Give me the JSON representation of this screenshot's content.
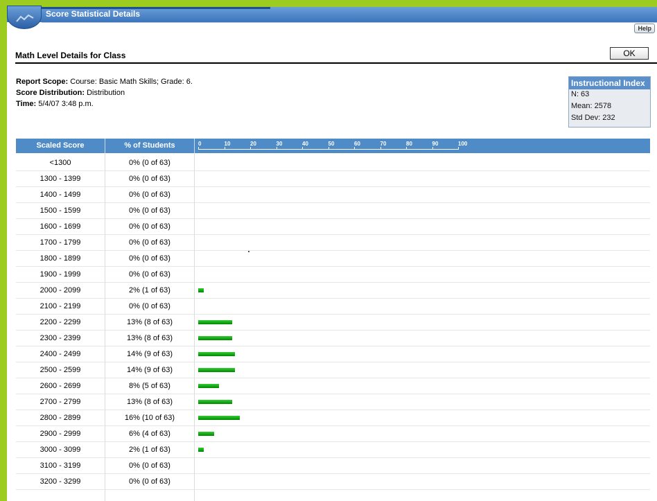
{
  "window": {
    "title": "Score Statistical Details",
    "help_label": "Help"
  },
  "header": {
    "page_title": "Math Level Details for Class",
    "ok_label": "OK"
  },
  "meta": {
    "scope_label": "Report Scope:",
    "scope_value": " Course: Basic Math Skills; Grade: 6.",
    "distribution_label": "Score Distribution:",
    "distribution_value": " Distribution",
    "time_label": "Time:",
    "time_value": " 5/4/07 3:48 p.m."
  },
  "index_box": {
    "title": "Instructional Index",
    "n": "N: 63",
    "mean": "Mean: 2578",
    "std_dev": "Std Dev: 232"
  },
  "table": {
    "col_score": "Scaled Score",
    "col_percent": "% of Students",
    "scale_ticks": [
      "0",
      "10",
      "20",
      "30",
      "40",
      "50",
      "60",
      "70",
      "80",
      "90",
      "100"
    ],
    "rows": [
      {
        "score": "<1300",
        "percent": "0% (0 of 63)",
        "value": 0
      },
      {
        "score": "1300 - 1399",
        "percent": "0% (0 of 63)",
        "value": 0
      },
      {
        "score": "1400 - 1499",
        "percent": "0% (0 of 63)",
        "value": 0
      },
      {
        "score": "1500 - 1599",
        "percent": "0% (0 of 63)",
        "value": 0
      },
      {
        "score": "1600 - 1699",
        "percent": "0% (0 of 63)",
        "value": 0
      },
      {
        "score": "1700 - 1799",
        "percent": "0% (0 of 63)",
        "value": 0
      },
      {
        "score": "1800 - 1899",
        "percent": "0% (0 of 63)",
        "value": 0
      },
      {
        "score": "1900 - 1999",
        "percent": "0% (0 of 63)",
        "value": 0
      },
      {
        "score": "2000 - 2099",
        "percent": "2% (1 of 63)",
        "value": 2
      },
      {
        "score": "2100 - 2199",
        "percent": "0% (0 of 63)",
        "value": 0
      },
      {
        "score": "2200 - 2299",
        "percent": "13% (8 of 63)",
        "value": 13
      },
      {
        "score": "2300 - 2399",
        "percent": "13% (8 of 63)",
        "value": 13
      },
      {
        "score": "2400 - 2499",
        "percent": "14% (9 of 63)",
        "value": 14
      },
      {
        "score": "2500 - 2599",
        "percent": "14% (9 of 63)",
        "value": 14
      },
      {
        "score": "2600 - 2699",
        "percent": "8% (5 of 63)",
        "value": 8
      },
      {
        "score": "2700 - 2799",
        "percent": "13% (8 of 63)",
        "value": 13
      },
      {
        "score": "2800 - 2899",
        "percent": "16% (10 of 63)",
        "value": 16
      },
      {
        "score": "2900 - 2999",
        "percent": "6% (4 of 63)",
        "value": 6
      },
      {
        "score": "3000 - 3099",
        "percent": "2% (1 of 63)",
        "value": 2
      },
      {
        "score": "3100 - 3199",
        "percent": "0% (0 of 63)",
        "value": 0
      },
      {
        "score": "3200 - 3299",
        "percent": "0% (0 of 63)",
        "value": 0
      }
    ]
  },
  "colors": {
    "frame": "#9ccc1f",
    "header_blue": "#4f8bc7",
    "bar_green": "#00aa00"
  }
}
